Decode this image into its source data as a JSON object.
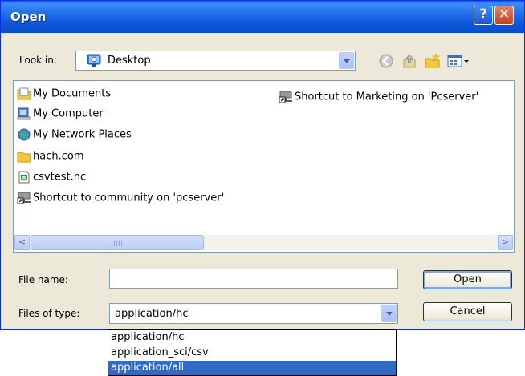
{
  "window": {
    "title": "Open",
    "help_glyph": "?",
    "close_glyph": "✕"
  },
  "look_in": {
    "label": "Look in:",
    "value": "Desktop",
    "icon": "desktop-icon"
  },
  "toolbar": [
    "back-icon",
    "up-folder-icon",
    "new-folder-icon",
    "view-menu-icon"
  ],
  "files": [
    {
      "name": "My Documents",
      "icon": "my-documents-icon"
    },
    {
      "name": "My Computer",
      "icon": "my-computer-icon"
    },
    {
      "name": "My Network Places",
      "icon": "network-places-icon"
    },
    {
      "name": "hach.com",
      "icon": "folder-icon"
    },
    {
      "name": "csvtest.hc",
      "icon": "hc-file-icon"
    },
    {
      "name": "Shortcut to community on 'pcserver'",
      "icon": "network-share-shortcut-icon"
    },
    {
      "name": "Shortcut to Marketing on 'Pcserver'",
      "icon": "network-share-shortcut-icon"
    }
  ],
  "scrollbar": {
    "left_glyph": "<",
    "right_glyph": ">",
    "grip_glyph": "III"
  },
  "file_name": {
    "label": "File name:",
    "value": ""
  },
  "file_type": {
    "label": "Files of type:",
    "value": "application/hc",
    "options": [
      "application/hc",
      "application_sci/csv",
      "application/all"
    ],
    "highlighted": "application/all"
  },
  "buttons": {
    "open": "Open",
    "cancel": "Cancel"
  },
  "colors": {
    "title_bar": "#0a5fe6",
    "selection": "#316ac5",
    "dialog_bg": "#ece9d8"
  }
}
